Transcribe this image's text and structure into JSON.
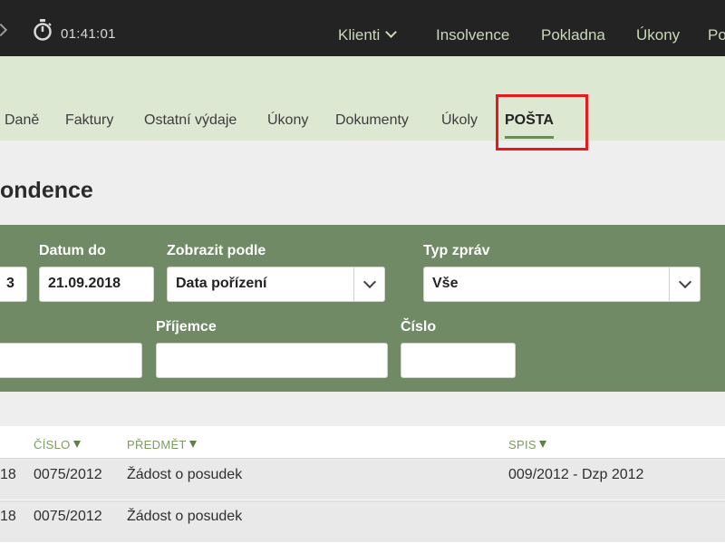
{
  "topbar": {
    "timer": "01:41:01",
    "nav": [
      "Klienti",
      "Insolvence",
      "Pokladna",
      "Úkony",
      "Po"
    ]
  },
  "tabs": [
    "Daně",
    "Faktury",
    "Ostatní výdaje",
    "Úkony",
    "Dokumenty",
    "Úkoly",
    "POŠTA"
  ],
  "page": {
    "title": "ondence"
  },
  "filter": {
    "date_from_value": "3",
    "date_to_label": "Datum do",
    "date_to_value": "21.09.2018",
    "show_by_label": "Zobrazit podle",
    "show_by_value": "Data pořízení",
    "type_label": "Typ zpráv",
    "type_value": "Vše",
    "recipient_label": "Příjemce",
    "number_label": "Číslo"
  },
  "table": {
    "headers": [
      "ČÍSLO",
      "PŘEDMĚT",
      "SPIS"
    ],
    "rows": [
      {
        "date_tail": "18",
        "number": "0075/2012",
        "subject": "Žádost o posudek",
        "file": "009/2012 - Dzp 2012"
      },
      {
        "date_tail": "18",
        "number": "0075/2012",
        "subject": "Žádost o posudek",
        "file": ""
      }
    ]
  },
  "colors": {
    "accent": "#6f8a64",
    "highlight": "#e8181f",
    "subheader": "#dde8d2"
  }
}
